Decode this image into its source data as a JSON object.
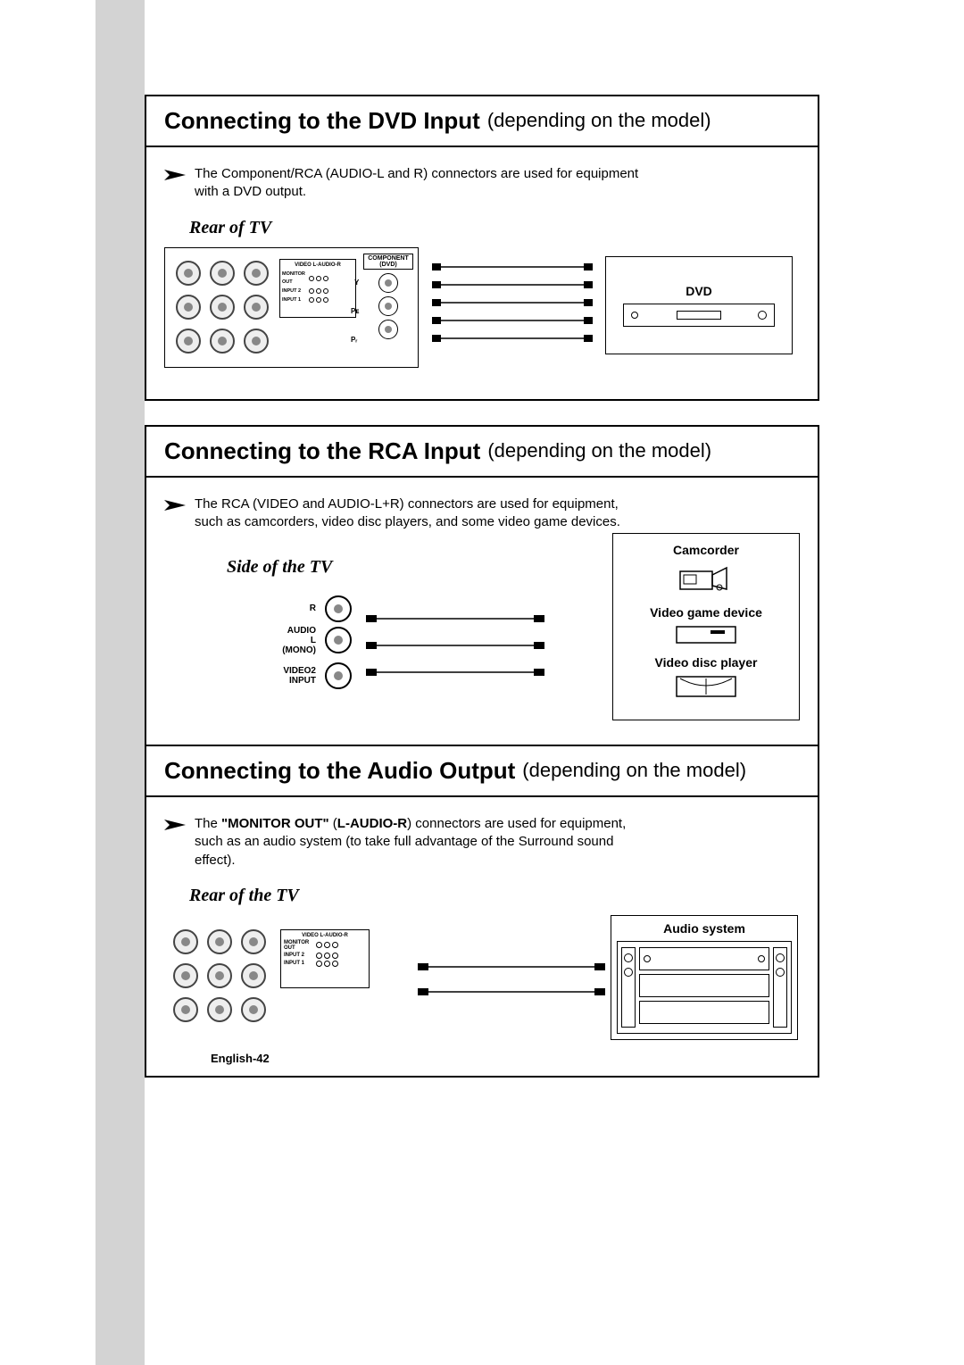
{
  "page_number": "English-42",
  "sections": {
    "dvd": {
      "title_bold": "Connecting to the DVD Input",
      "title_light": "(depending on the model)",
      "note": "The Component/RCA (AUDIO-L and R) connectors are used for equipment with a DVD output.",
      "caption": "Rear of TV",
      "panel": {
        "header": "VIDEO   L-AUDIO-R",
        "rows": [
          "MONITOR OUT",
          "INPUT 2",
          "INPUT 1"
        ]
      },
      "component": {
        "title1": "COMPONENT",
        "title2": "(DVD)",
        "labels": [
          "Y",
          "Pᴇ",
          "Pᵣ"
        ]
      },
      "device_label": "DVD"
    },
    "rca": {
      "title_bold": "Connecting to the RCA Input",
      "title_light": "(depending on the model)",
      "note": "The RCA (VIDEO and AUDIO-L+R) connectors are used for equipment, such as camcorders, video disc players, and some video game devices.",
      "caption": "Side of the TV",
      "side_ports": {
        "r": "R",
        "audio": "AUDIO",
        "l": "L",
        "mono": "(MONO)",
        "video2": "VIDEO2",
        "input": "INPUT"
      },
      "devices": {
        "camcorder": "Camcorder",
        "game": "Video game device",
        "disc": "Video disc player"
      }
    },
    "audio": {
      "title_bold": "Connecting to the Audio Output",
      "title_light": "(depending on the model)",
      "note_pre": "The ",
      "note_bold1": "\"MONITOR OUT\"",
      "note_mid": " (",
      "note_bold2": "L-AUDIO-R",
      "note_post": ") connectors are used for equipment, such as an audio system (to take full advantage of the Surround sound effect).",
      "caption": "Rear of the TV",
      "panel": {
        "header": "VIDEO   L-AUDIO-R",
        "rows": [
          "MONITOR OUT",
          "INPUT 2",
          "INPUT 1"
        ]
      },
      "device_label": "Audio system"
    }
  }
}
